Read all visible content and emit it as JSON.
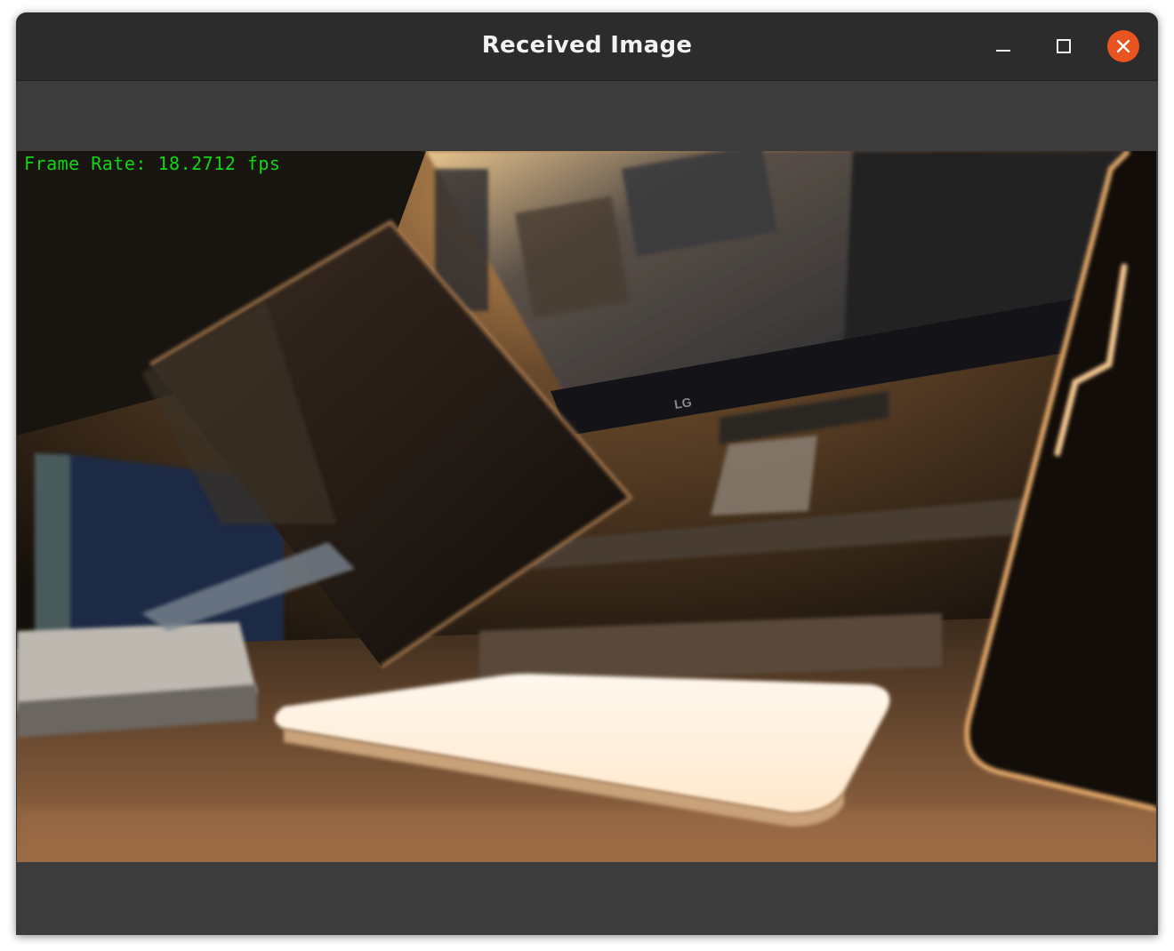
{
  "window": {
    "title": "Received Image",
    "controls": {
      "minimize_icon": "minimize-icon",
      "maximize_icon": "maximize-icon",
      "close_icon": "close-icon",
      "close_color": "#e95420"
    }
  },
  "image": {
    "overlay_text": "Frame Rate: 18.2712 fps",
    "overlay_color": "#12d612",
    "monitor_brand": "LG"
  }
}
